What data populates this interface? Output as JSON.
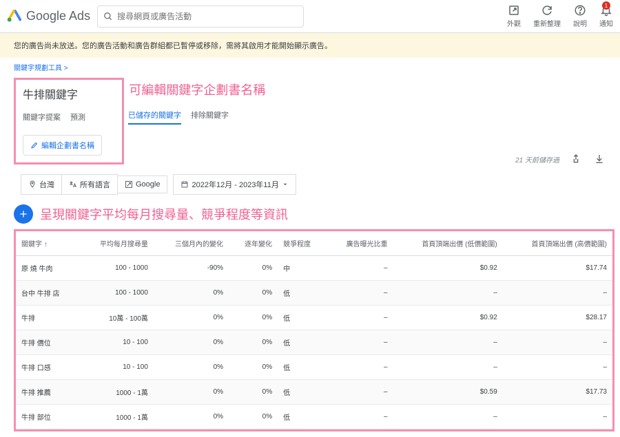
{
  "header": {
    "brand": "Google Ads",
    "search_placeholder": "搜尋網頁或廣告活動",
    "actions": [
      {
        "label": "外觀"
      },
      {
        "label": "重新整理"
      },
      {
        "label": "說明"
      },
      {
        "label": "通知",
        "badge": "1"
      }
    ]
  },
  "notice": "您的廣告尚未放送。您的廣告活動和廣告群組都已暫停或移除，需將其啟用才能開始顯示廣告。",
  "breadcrumb": "關鍵字規劃工具 >",
  "plan": {
    "title": "牛排關鍵字",
    "annotation1": "可編輯關鍵字企劃書名稱",
    "tabs": [
      "關鍵字提案",
      "預測",
      "已儲存的關鍵字",
      "排除關鍵字"
    ],
    "active_tab": 2,
    "edit_btn": "編輯企劃書名稱",
    "meta_time": "21 天前儲存過"
  },
  "filters": {
    "location": "台灣",
    "language": "所有語言",
    "source": "Google",
    "daterange": "2022年12月 - 2023年11月"
  },
  "annotation2": "呈現關鍵字平均每月搜尋量、競爭程度等資訊",
  "table": {
    "headers": [
      "關鍵字 ↑",
      "平均每月搜尋量",
      "三個月內的變化",
      "逐年變化",
      "競爭程度",
      "廣告曝光比重",
      "首頁頂端出價 (低價範圍)",
      "首頁頂端出價 (高價範圍)"
    ],
    "rows": [
      [
        "原 燒 牛肉",
        "100 - 1000",
        "-90%",
        "0%",
        "中",
        "–",
        "$0.92",
        "$17.74"
      ],
      [
        "台中 牛排 店",
        "100 - 1000",
        "0%",
        "0%",
        "低",
        "–",
        "–",
        "–"
      ],
      [
        "牛排",
        "10萬 - 100萬",
        "0%",
        "0%",
        "低",
        "–",
        "$0.92",
        "$28.17"
      ],
      [
        "牛排 價位",
        "10 - 100",
        "0%",
        "0%",
        "低",
        "–",
        "–",
        "–"
      ],
      [
        "牛排 口感",
        "10 - 100",
        "0%",
        "0%",
        "低",
        "–",
        "–",
        "–"
      ],
      [
        "牛排 推薦",
        "1000 - 1萬",
        "0%",
        "0%",
        "低",
        "–",
        "$0.59",
        "$17.73"
      ],
      [
        "牛排 部位",
        "1000 - 1萬",
        "0%",
        "0%",
        "低",
        "–",
        "–",
        "–"
      ]
    ]
  }
}
